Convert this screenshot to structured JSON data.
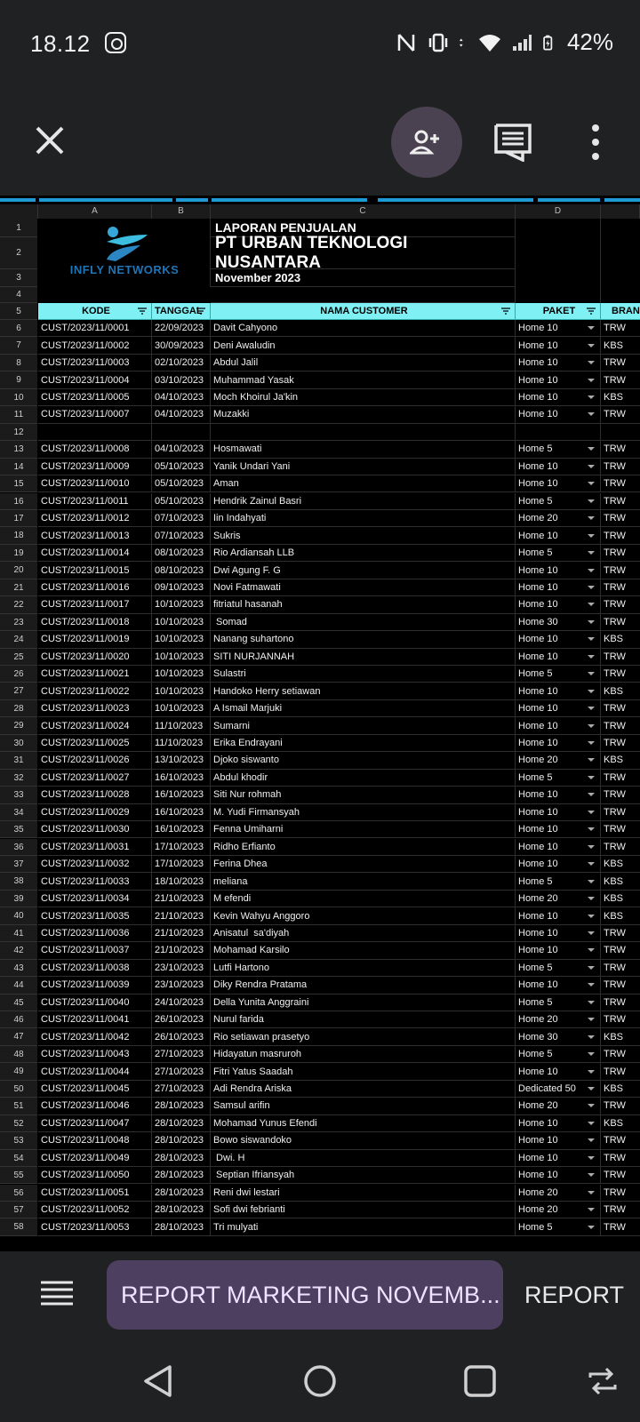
{
  "status": {
    "time": "18.12",
    "battery": "42%"
  },
  "sheet": {
    "columns": [
      "A",
      "B",
      "C",
      "D"
    ],
    "title_rows": [
      {
        "num": "1",
        "text": "LAPORAN PENJUALAN"
      },
      {
        "num": "2",
        "text": "PT URBAN TEKNOLOGI NUSANTARA"
      },
      {
        "num": "3",
        "text": "November 2023"
      }
    ],
    "logo_text": "INFLY NETWORKS",
    "blank_row_num": "4",
    "header": {
      "num": "5",
      "kode": "KODE",
      "tanggal": "TANGGAL",
      "nama": "NAMA CUSTOMER",
      "paket": "PAKET",
      "brand": "BRAN"
    },
    "rows": [
      {
        "n": "6",
        "k": "CUST/2023/11/0001",
        "t": "22/09/2023",
        "c": "Davit Cahyono",
        "p": "Home 10",
        "b": "TRW"
      },
      {
        "n": "7",
        "k": "CUST/2023/11/0002",
        "t": "30/09/2023",
        "c": "Deni Awaludin",
        "p": "Home 10",
        "b": "KBS"
      },
      {
        "n": "8",
        "k": "CUST/2023/11/0003",
        "t": "02/10/2023",
        "c": "Abdul Jalil",
        "p": "Home 10",
        "b": "TRW"
      },
      {
        "n": "9",
        "k": "CUST/2023/11/0004",
        "t": "03/10/2023",
        "c": "Muhammad Yasak",
        "p": "Home 10",
        "b": "TRW"
      },
      {
        "n": "10",
        "k": "CUST/2023/11/0005",
        "t": "04/10/2023",
        "c": "Moch Khoirul Ja'kin",
        "p": "Home 10",
        "b": "KBS"
      },
      {
        "n": "11",
        "k": "CUST/2023/11/0007",
        "t": "04/10/2023",
        "c": "Muzakki",
        "p": "Home 10",
        "b": "TRW"
      },
      {
        "n": "12",
        "k": "",
        "t": "",
        "c": "",
        "p": "",
        "b": ""
      },
      {
        "n": "13",
        "k": "CUST/2023/11/0008",
        "t": "04/10/2023",
        "c": "Hosmawati",
        "p": "Home 5",
        "b": "TRW"
      },
      {
        "n": "14",
        "k": "CUST/2023/11/0009",
        "t": "05/10/2023",
        "c": "Yanik Undari Yani",
        "p": "Home 10",
        "b": "TRW"
      },
      {
        "n": "15",
        "k": "CUST/2023/11/0010",
        "t": "05/10/2023",
        "c": "Aman",
        "p": "Home 10",
        "b": "TRW"
      },
      {
        "n": "16",
        "k": "CUST/2023/11/0011",
        "t": "05/10/2023",
        "c": "Hendrik Zainul Basri",
        "p": "Home 5",
        "b": "TRW"
      },
      {
        "n": "17",
        "k": "CUST/2023/11/0012",
        "t": "07/10/2023",
        "c": "Iin Indahyati",
        "p": "Home 20",
        "b": "TRW"
      },
      {
        "n": "18",
        "k": "CUST/2023/11/0013",
        "t": "07/10/2023",
        "c": "Sukris",
        "p": "Home 10",
        "b": "TRW"
      },
      {
        "n": "19",
        "k": "CUST/2023/11/0014",
        "t": "08/10/2023",
        "c": "Rio Ardiansah LLB",
        "p": "Home 5",
        "b": "TRW"
      },
      {
        "n": "20",
        "k": "CUST/2023/11/0015",
        "t": "08/10/2023",
        "c": "Dwi Agung F. G",
        "p": "Home 10",
        "b": "TRW"
      },
      {
        "n": "21",
        "k": "CUST/2023/11/0016",
        "t": "09/10/2023",
        "c": "Novi Fatmawati",
        "p": "Home 10",
        "b": "TRW"
      },
      {
        "n": "22",
        "k": "CUST/2023/11/0017",
        "t": "10/10/2023",
        "c": "fitriatul hasanah",
        "p": "Home 10",
        "b": "TRW"
      },
      {
        "n": "23",
        "k": "CUST/2023/11/0018",
        "t": "10/10/2023",
        "c": " Somad",
        "p": "Home 30",
        "b": "TRW"
      },
      {
        "n": "24",
        "k": "CUST/2023/11/0019",
        "t": "10/10/2023",
        "c": "Nanang suhartono",
        "p": "Home 10",
        "b": "KBS"
      },
      {
        "n": "25",
        "k": "CUST/2023/11/0020",
        "t": "10/10/2023",
        "c": "SITI NURJANNAH",
        "p": "Home 10",
        "b": "TRW"
      },
      {
        "n": "26",
        "k": "CUST/2023/11/0021",
        "t": "10/10/2023",
        "c": "Sulastri",
        "p": "Home 5",
        "b": "TRW"
      },
      {
        "n": "27",
        "k": "CUST/2023/11/0022",
        "t": "10/10/2023",
        "c": "Handoko Herry setiawan",
        "p": "Home 10",
        "b": "KBS"
      },
      {
        "n": "28",
        "k": "CUST/2023/11/0023",
        "t": "10/10/2023",
        "c": "A Ismail Marjuki",
        "p": "Home 10",
        "b": "TRW"
      },
      {
        "n": "29",
        "k": "CUST/2023/11/0024",
        "t": "11/10/2023",
        "c": "Sumarni",
        "p": "Home 10",
        "b": "TRW"
      },
      {
        "n": "30",
        "k": "CUST/2023/11/0025",
        "t": "11/10/2023",
        "c": "Erika Endrayani",
        "p": "Home 10",
        "b": "TRW"
      },
      {
        "n": "31",
        "k": "CUST/2023/11/0026",
        "t": "13/10/2023",
        "c": "Djoko siswanto",
        "p": "Home 20",
        "b": "KBS"
      },
      {
        "n": "32",
        "k": "CUST/2023/11/0027",
        "t": "16/10/2023",
        "c": "Abdul khodir",
        "p": "Home 5",
        "b": "TRW"
      },
      {
        "n": "33",
        "k": "CUST/2023/11/0028",
        "t": "16/10/2023",
        "c": "Siti Nur rohmah",
        "p": "Home 10",
        "b": "TRW"
      },
      {
        "n": "34",
        "k": "CUST/2023/11/0029",
        "t": "16/10/2023",
        "c": "M. Yudi Firmansyah",
        "p": "Home 10",
        "b": "TRW"
      },
      {
        "n": "35",
        "k": "CUST/2023/11/0030",
        "t": "16/10/2023",
        "c": "Fenna Umiharni",
        "p": "Home 10",
        "b": "TRW"
      },
      {
        "n": "36",
        "k": "CUST/2023/11/0031",
        "t": "17/10/2023",
        "c": "Ridho Erfianto",
        "p": "Home 10",
        "b": "TRW"
      },
      {
        "n": "37",
        "k": "CUST/2023/11/0032",
        "t": "17/10/2023",
        "c": "Ferina Dhea",
        "p": "Home 10",
        "b": "KBS"
      },
      {
        "n": "38",
        "k": "CUST/2023/11/0033",
        "t": "18/10/2023",
        "c": "meliana",
        "p": "Home 5",
        "b": "KBS"
      },
      {
        "n": "39",
        "k": "CUST/2023/11/0034",
        "t": "21/10/2023",
        "c": "M efendi",
        "p": "Home 20",
        "b": "KBS"
      },
      {
        "n": "40",
        "k": "CUST/2023/11/0035",
        "t": "21/10/2023",
        "c": "Kevin Wahyu Anggoro",
        "p": "Home 10",
        "b": "KBS"
      },
      {
        "n": "41",
        "k": "CUST/2023/11/0036",
        "t": "21/10/2023",
        "c": "Anisatul  sa'diyah",
        "p": "Home 10",
        "b": "TRW"
      },
      {
        "n": "42",
        "k": "CUST/2023/11/0037",
        "t": "21/10/2023",
        "c": "Mohamad Karsilo",
        "p": "Home 10",
        "b": "TRW"
      },
      {
        "n": "43",
        "k": "CUST/2023/11/0038",
        "t": "23/10/2023",
        "c": "Lutfi Hartono",
        "p": "Home 5",
        "b": "TRW"
      },
      {
        "n": "44",
        "k": "CUST/2023/11/0039",
        "t": "23/10/2023",
        "c": "Diky Rendra Pratama",
        "p": "Home 10",
        "b": "TRW"
      },
      {
        "n": "45",
        "k": "CUST/2023/11/0040",
        "t": "24/10/2023",
        "c": "Della Yunita Anggraini",
        "p": "Home 5",
        "b": "TRW"
      },
      {
        "n": "46",
        "k": "CUST/2023/11/0041",
        "t": "26/10/2023",
        "c": "Nurul farida",
        "p": "Home 20",
        "b": "TRW"
      },
      {
        "n": "47",
        "k": "CUST/2023/11/0042",
        "t": "26/10/2023",
        "c": "Rio setiawan prasetyo",
        "p": "Home 30",
        "b": "KBS"
      },
      {
        "n": "48",
        "k": "CUST/2023/11/0043",
        "t": "27/10/2023",
        "c": "Hidayatun masruroh",
        "p": "Home 5",
        "b": "TRW"
      },
      {
        "n": "49",
        "k": "CUST/2023/11/0044",
        "t": "27/10/2023",
        "c": "Fitri Yatus Saadah",
        "p": "Home 10",
        "b": "TRW"
      },
      {
        "n": "50",
        "k": "CUST/2023/11/0045",
        "t": "27/10/2023",
        "c": "Adi Rendra Ariska",
        "p": "Dedicated 50",
        "b": "KBS"
      },
      {
        "n": "51",
        "k": "CUST/2023/11/0046",
        "t": "28/10/2023",
        "c": "Samsul arifin",
        "p": "Home 20",
        "b": "TRW"
      },
      {
        "n": "52",
        "k": "CUST/2023/11/0047",
        "t": "28/10/2023",
        "c": "Mohamad Yunus Efendi",
        "p": "Home 10",
        "b": "KBS"
      },
      {
        "n": "53",
        "k": "CUST/2023/11/0048",
        "t": "28/10/2023",
        "c": "Bowo siswandoko",
        "p": "Home 10",
        "b": "TRW"
      },
      {
        "n": "54",
        "k": "CUST/2023/11/0049",
        "t": "28/10/2023",
        "c": " Dwi. H",
        "p": "Home 10",
        "b": "TRW"
      },
      {
        "n": "55",
        "k": "CUST/2023/11/0050",
        "t": "28/10/2023",
        "c": " Septian Ifriansyah",
        "p": "Home 10",
        "b": "TRW"
      },
      {
        "n": "56",
        "k": "CUST/2023/11/0051",
        "t": "28/10/2023",
        "c": "Reni dwi lestari",
        "p": "Home 20",
        "b": "TRW"
      },
      {
        "n": "57",
        "k": "CUST/2023/11/0052",
        "t": "28/10/2023",
        "c": "Sofi dwi febrianti",
        "p": "Home 20",
        "b": "TRW"
      },
      {
        "n": "58",
        "k": "CUST/2023/11/0053",
        "t": "28/10/2023",
        "c": "Tri mulyati",
        "p": "Home 5",
        "b": "TRW"
      }
    ]
  },
  "tabs": {
    "active": "REPORT MARKETING NOVEMB...",
    "next": "REPORT"
  }
}
